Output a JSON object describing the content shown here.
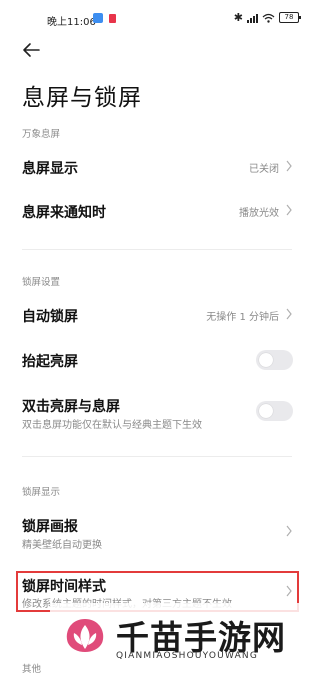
{
  "status_bar": {
    "time": "晚上11:06",
    "battery": "78"
  },
  "page": {
    "title": "息屏与锁屏"
  },
  "sections": [
    {
      "header": "万象息屏",
      "items": [
        {
          "title": "息屏显示",
          "value": "已关闭",
          "control": "chevron"
        },
        {
          "title": "息屏来通知时",
          "value": "播放光效",
          "control": "chevron"
        }
      ]
    },
    {
      "header": "锁屏设置",
      "items": [
        {
          "title": "自动锁屏",
          "value": "无操作 1 分钟后",
          "control": "chevron"
        },
        {
          "title": "抬起亮屏",
          "control": "toggle",
          "on": false
        },
        {
          "title": "双击亮屏与息屏",
          "subtitle": "双击息屏功能仅在默认与经典主题下生效",
          "control": "toggle",
          "on": false
        }
      ]
    },
    {
      "header": "锁屏显示",
      "items": [
        {
          "title": "锁屏画报",
          "subtitle": "精美壁纸自动更换",
          "control": "chevron"
        },
        {
          "title": "锁屏时间样式",
          "subtitle": "修改系统主题的时间样式，对第三方主题不生效",
          "control": "chevron",
          "highlighted": true
        }
      ]
    }
  ],
  "next_section_header": "其他",
  "watermark": {
    "title": "千苗手游网",
    "subtitle": "QIANMIAOSHOUYOUWANG"
  },
  "colors": {
    "highlight": "#e33b3b",
    "secondary_text": "#8a8a8a",
    "toggle_off": "#e9e9ec"
  }
}
